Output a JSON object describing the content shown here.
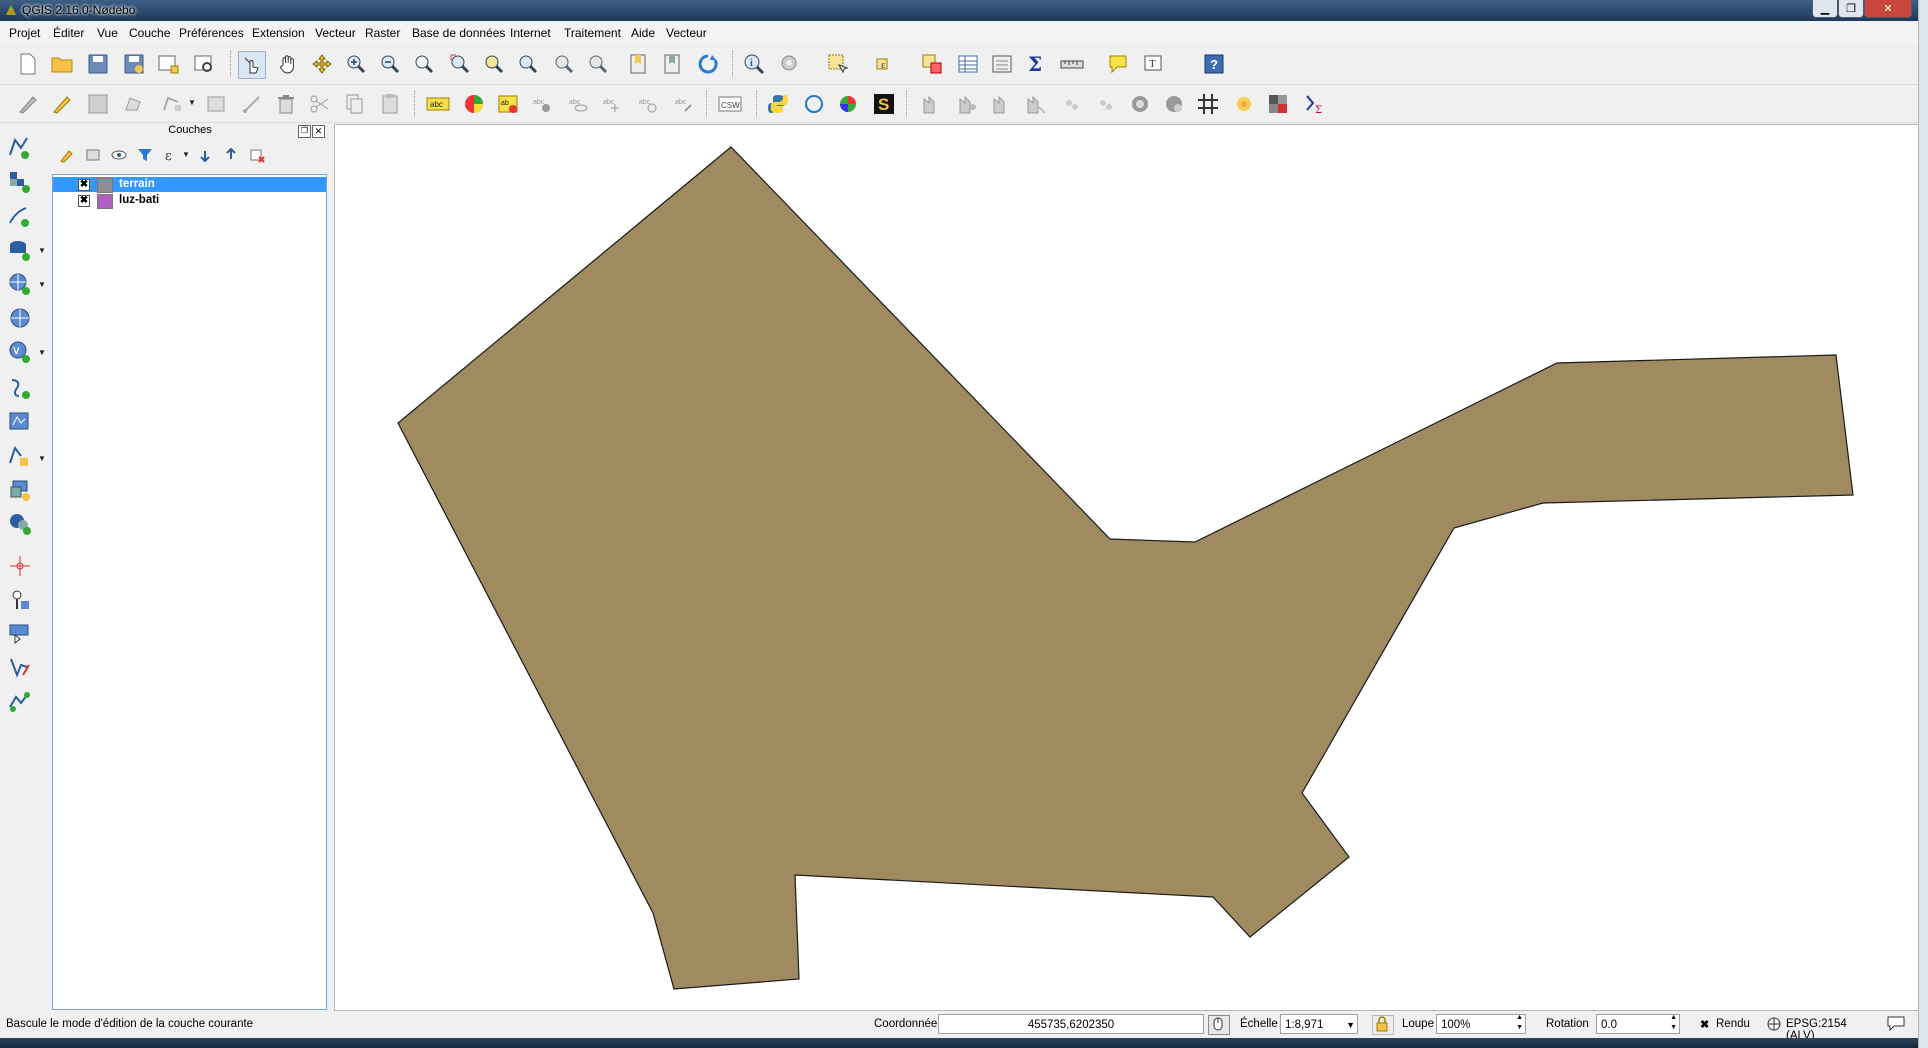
{
  "window": {
    "title": "QGIS 2.16.0-Nødebo",
    "controls": [
      "minimize",
      "maximize",
      "close"
    ]
  },
  "menubar": {
    "items": [
      "Projet",
      "Éditer",
      "Vue",
      "Couche",
      "Préférences",
      "Extension",
      "Vecteur",
      "Raster",
      "Base de données",
      "Internet",
      "Traitement",
      "Aide",
      "Vecteur"
    ]
  },
  "toolbars": {
    "row1_icons": [
      "new-project",
      "open-project",
      "save-project",
      "save-as",
      "print-composer",
      "composer-manager",
      "select-pan-touch",
      "pan",
      "pan-to-selection",
      "zoom-in",
      "zoom-out",
      "zoom-native",
      "zoom-full",
      "zoom-to-selection",
      "zoom-to-layer",
      "zoom-last",
      "zoom-next",
      "new-bookmark",
      "show-bookmarks",
      "refresh",
      "identify",
      "actions",
      "select-features",
      "deselect",
      "open-attribute-table",
      "field-calculator",
      "statistics",
      "measure",
      "map-tips",
      "text-annotation",
      "help"
    ],
    "row1_active": "select-pan-touch",
    "row2_labels": {
      "csw_button": "CSW"
    },
    "row2_icons": [
      "current-edits",
      "toggle-editing",
      "save-edits",
      "add-feature",
      "move-feature",
      "node-tool",
      "delete-selected",
      "cut-features",
      "copy-features",
      "paste-features",
      "label-tool",
      "diagram-tool",
      "layer-labeling",
      "pin-labels",
      "show-hide-labels",
      "move-label",
      "rotate-label",
      "change-label",
      "metasearch",
      "python-console",
      "georeferencer",
      "topology",
      "sextante",
      "processing-terrain",
      "processing-raster",
      "processing-vector",
      "processing-model",
      "processing-script",
      "processing-history",
      "processing-toolbox",
      "grid",
      "heatmap",
      "raster-calc",
      "sum"
    ]
  },
  "left_toolbar": {
    "icons": [
      "add-vector-layer",
      "add-raster-layer",
      "add-delimited-text",
      "add-spatialite",
      "add-postgis",
      "add-wms",
      "add-wfs",
      "add-wcs",
      "new-shapefile",
      "new-spatialite",
      "new-virtual",
      "add-vector-tile",
      "new-memory-layer",
      "gps-tools",
      "georef",
      "add-csv",
      "add-oracle",
      "show-layers"
    ]
  },
  "layers_panel": {
    "title": "Couches",
    "tool_icons": [
      "style-icon",
      "add-group-icon",
      "visibility-icon",
      "filter-icon",
      "expression-filter-icon",
      "expand-icon",
      "collapse-icon",
      "remove-icon"
    ],
    "layers": [
      {
        "name": "terrain",
        "checked": true,
        "swatch": "#8e8e8e",
        "selected": true
      },
      {
        "name": "luz-bati",
        "checked": true,
        "swatch": "#b05fc0",
        "selected": false
      }
    ]
  },
  "map": {
    "polygon_fill": "#a08a5f",
    "polygon_stroke": "#1a1a1a",
    "background": "#ffffff"
  },
  "statusbar": {
    "message": "Bascule le mode d'édition de la couche courante",
    "coord_label": "Coordonnée",
    "coord_value": "455735,6202350",
    "scale_label": "Échelle",
    "scale_value": "1:8,971",
    "magnifier_label": "Loupe",
    "magnifier_value": "100%",
    "rotation_label": "Rotation",
    "rotation_value": "0.0",
    "render_label": "Rendu",
    "render_checked": true,
    "crs_label": "EPSG:2154 (ALV)"
  },
  "colors": {
    "selection": "#3399ff",
    "accent": "#1e90ff"
  }
}
